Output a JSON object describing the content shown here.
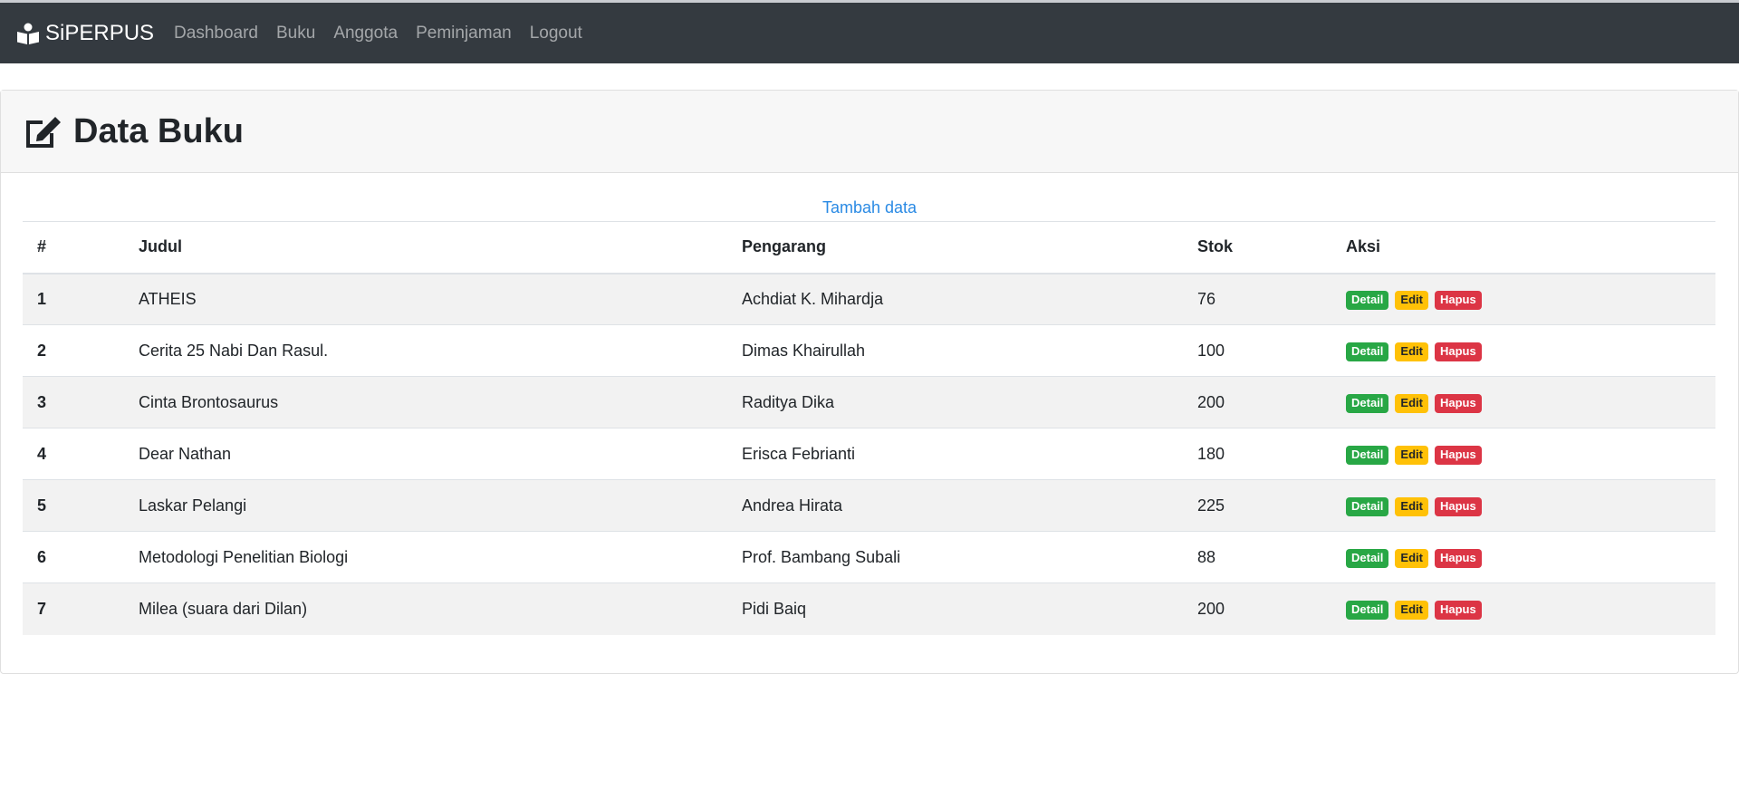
{
  "navbar": {
    "brand": "SiPERPUS",
    "links": [
      "Dashboard",
      "Buku",
      "Anggota",
      "Peminjaman",
      "Logout"
    ]
  },
  "page": {
    "title": "Data Buku",
    "add_link": "Tambah data"
  },
  "table": {
    "headers": [
      "#",
      "Judul",
      "Pengarang",
      "Stok",
      "Aksi"
    ],
    "actions": {
      "detail": "Detail",
      "edit": "Edit",
      "hapus": "Hapus"
    },
    "rows": [
      {
        "no": "1",
        "judul": "ATHEIS",
        "pengarang": "Achdiat K. Mihardja",
        "stok": "76"
      },
      {
        "no": "2",
        "judul": "Cerita 25 Nabi Dan Rasul.",
        "pengarang": "Dimas Khairullah",
        "stok": "100"
      },
      {
        "no": "3",
        "judul": "Cinta Brontosaurus",
        "pengarang": "Raditya Dika",
        "stok": "200"
      },
      {
        "no": "4",
        "judul": "Dear Nathan",
        "pengarang": "Erisca Febrianti",
        "stok": "180"
      },
      {
        "no": "5",
        "judul": "Laskar Pelangi",
        "pengarang": "Andrea Hirata",
        "stok": "225"
      },
      {
        "no": "6",
        "judul": "Metodologi Penelitian Biologi",
        "pengarang": "Prof. Bambang Subali",
        "stok": "88"
      },
      {
        "no": "7",
        "judul": "Milea (suara dari Dilan)",
        "pengarang": "Pidi Baiq",
        "stok": "200"
      }
    ]
  },
  "colors": {
    "navbar_bg": "#343a40",
    "detail": "#28a745",
    "edit": "#ffc107",
    "hapus": "#dc3545",
    "link": "#2a8ae4"
  }
}
